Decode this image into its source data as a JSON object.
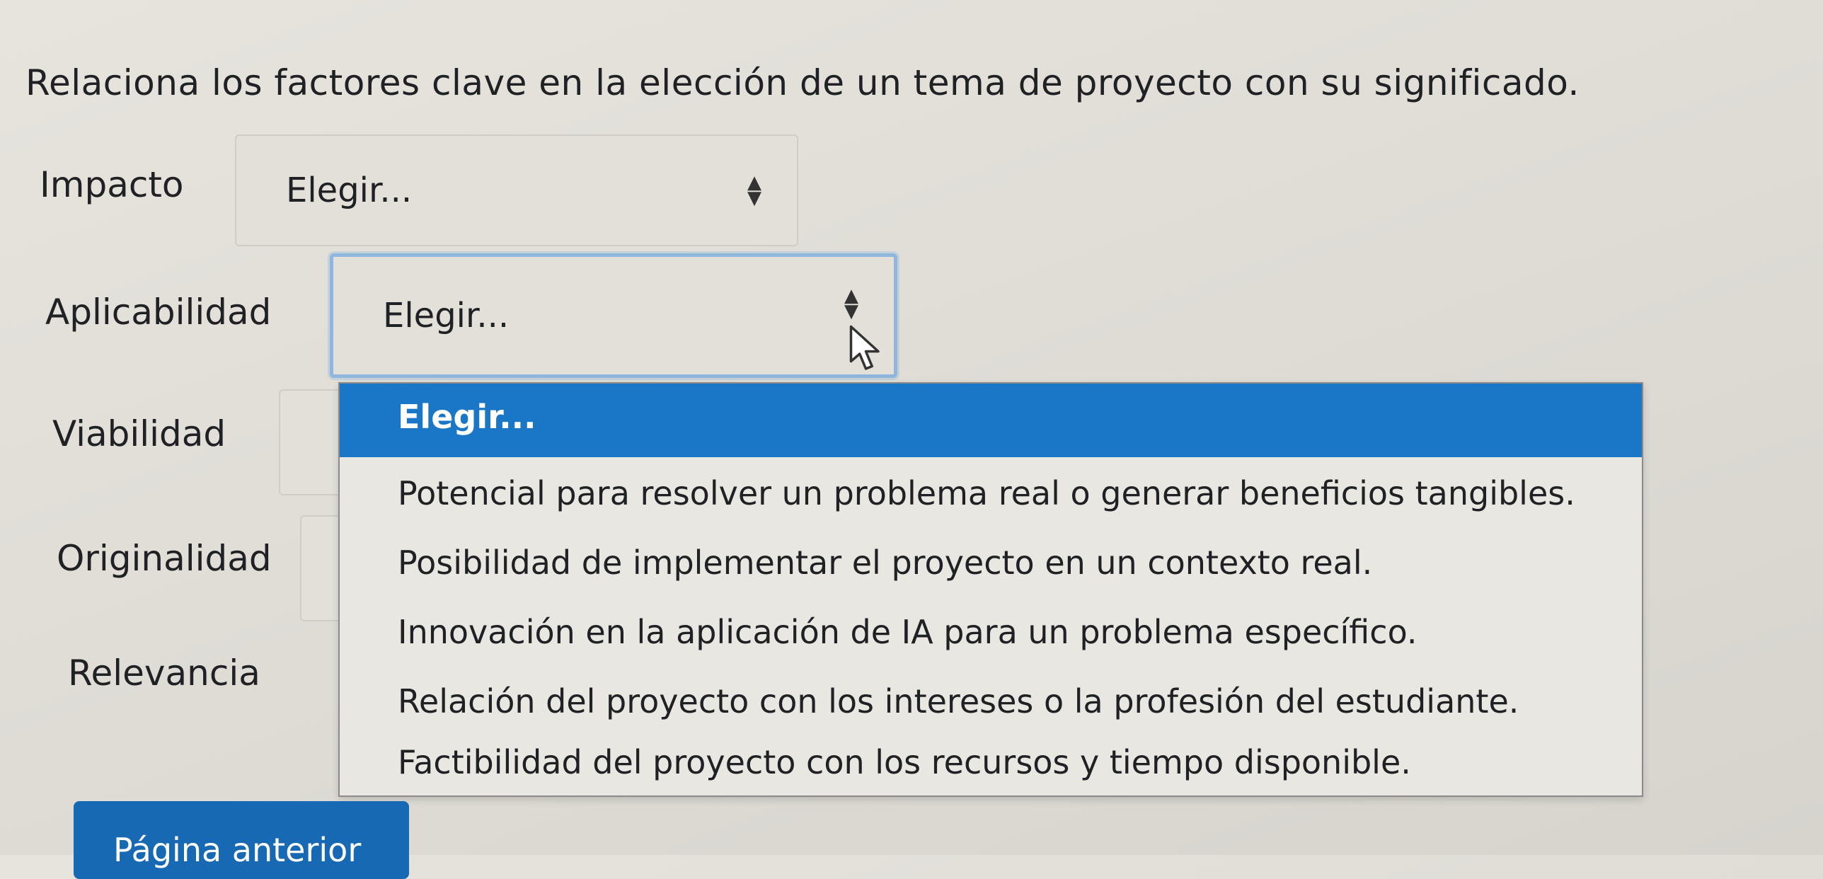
{
  "question": "Relaciona los factores clave en la elección de un tema de proyecto con su significado.",
  "rows": [
    {
      "label": "Impacto",
      "select_value": "Elegir..."
    },
    {
      "label": "Aplicabilidad",
      "select_value": "Elegir..."
    },
    {
      "label": "Viabilidad",
      "select_value": ""
    },
    {
      "label": "Originalidad",
      "select_value": ""
    },
    {
      "label": "Relevancia",
      "select_value": ""
    }
  ],
  "dropdown": {
    "options": [
      "Elegir...",
      "Potencial para resolver un problema real o generar beneficios tangibles.",
      "Posibilidad de implementar el proyecto en un contexto real.",
      "Innovación en la aplicación de IA para un problema específico.",
      "Relación del proyecto con los intereses o la profesión del estudiante.",
      "Factibilidad del proyecto con los recursos y tiempo disponible."
    ],
    "selected_index": 0
  },
  "buttons": {
    "previous_page": "Página anterior"
  },
  "colors": {
    "highlight": "#1a76c6",
    "button": "#1769b3",
    "focus_border": "#8fb7de"
  },
  "icons": {
    "select_arrows": "up-down-arrows-icon",
    "cursor": "mouse-pointer-icon"
  }
}
